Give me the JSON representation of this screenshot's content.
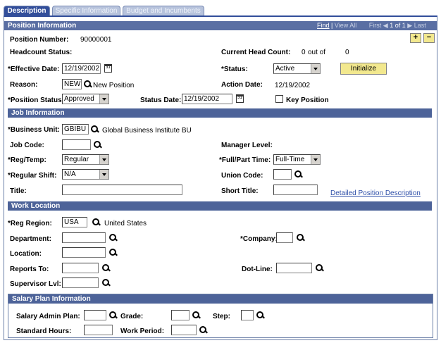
{
  "tabs": [
    "Description",
    "Specific Information",
    "Budget and Incumbents"
  ],
  "position_info": {
    "header": "Position Information",
    "nav": {
      "find": "Find",
      "view_all": "View All",
      "first": "First",
      "range": "1 of 1",
      "last": "Last"
    },
    "position_number_label": "Position Number:",
    "position_number": "90000001",
    "headcount_status_label": "Headcount Status:",
    "current_head_count_label": "Current Head Count:",
    "current_head_count": "0",
    "out_of_label": "out of",
    "out_of_value": "0",
    "effective_date_label": "*Effective Date:",
    "effective_date": "12/19/2002",
    "status_label": "*Status:",
    "status": "Active",
    "initialize_button": "Initialize",
    "reason_label": "Reason:",
    "reason_code": "NEW",
    "reason_desc": "New Position",
    "action_date_label": "Action Date:",
    "action_date": "12/19/2002",
    "position_status_label": "*Position Status:",
    "position_status": "Approved",
    "status_date_label": "Status Date:",
    "status_date": "12/19/2002",
    "key_position_label": "Key Position",
    "add_row": "+",
    "delete_row": "−"
  },
  "job_info": {
    "header": "Job Information",
    "business_unit_label": "*Business Unit:",
    "business_unit": "GBIBU",
    "business_unit_desc": "Global Business Institute BU",
    "job_code_label": "Job Code:",
    "job_code": "",
    "manager_level_label": "Manager Level:",
    "reg_temp_label": "*Reg/Temp:",
    "reg_temp": "Regular",
    "full_part_label": "*Full/Part Time:",
    "full_part": "Full-Time",
    "regular_shift_label": "*Regular Shift:",
    "regular_shift": "N/A",
    "union_code_label": "Union Code:",
    "union_code": "",
    "title_label": "Title:",
    "title": "",
    "short_title_label": "Short Title:",
    "short_title": "",
    "detailed_link": "Detailed Position Description"
  },
  "work_location": {
    "header": "Work Location",
    "reg_region_label": "*Reg Region:",
    "reg_region": "USA",
    "reg_region_desc": "United States",
    "department_label": "Department:",
    "company_label": "*Company:",
    "location_label": "Location:",
    "reports_to_label": "Reports To:",
    "dot_line_label": "Dot-Line:",
    "supervisor_label": "Supervisor Lvl:"
  },
  "salary_plan": {
    "header": "Salary Plan Information",
    "salary_admin_plan_label": "Salary Admin Plan:",
    "grade_label": "Grade:",
    "step_label": "Step:",
    "standard_hours_label": "Standard Hours:",
    "work_period_label": "Work Period:"
  },
  "icons": {
    "lookup": "magnifier-icon",
    "calendar": "calendar-icon",
    "dropdown": "chevron-down-icon"
  },
  "calendar_glyph": "31",
  "colors": {
    "tab_active": "#324e9a",
    "section_bar": "#5a6fa3",
    "button": "#f2e88e",
    "link": "#2e4fa8"
  }
}
